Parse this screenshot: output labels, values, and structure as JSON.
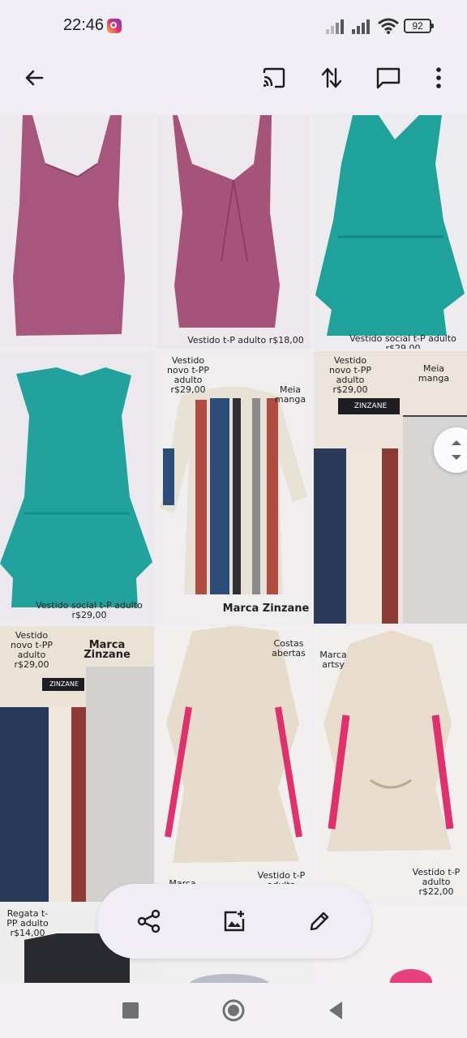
{
  "status": {
    "time": "22:46",
    "battery": "92"
  },
  "captions": {
    "t2": "Vestido t-P adulto r$18,00",
    "t3": "Vestido social t-P adulto r$29,00",
    "t4": "Vestido social t-P adulto r$29,00",
    "t5_price": "Vestido novo t-PP adulto r$29,00",
    "t5_sleeve": "Meia manga",
    "t5_brand": "Marca Zinzane",
    "t6_price": "Vestido novo t-PP adulto r$29,00",
    "t6_sleeve": "Meia manga",
    "t6_tag": "ZINZANE",
    "t7_price": "Vestido novo t-PP adulto r$29,00",
    "t7_brand": "Marca Zinzane",
    "t7_tag": "ZINZANE",
    "t8_back": "Costas abertas",
    "t8_size": "Vestido t-P adulto",
    "t8_brand": "Marca",
    "t9_brand": "Marca artsy",
    "t9_price": "Vestido t-P adulto r$22,00",
    "t10_price": "Regata t-PP adulto r$14,00"
  },
  "icons": {
    "back": "arrow-back-icon",
    "cast": "cast-icon",
    "sort": "swap-vertical-icon",
    "comment": "comment-icon",
    "more": "more-vert-icon",
    "share": "share-icon",
    "add_photo": "add-photo-icon",
    "edit": "edit-icon"
  },
  "colors": {
    "accent": "#1d1b20",
    "background": "#efedf3"
  }
}
